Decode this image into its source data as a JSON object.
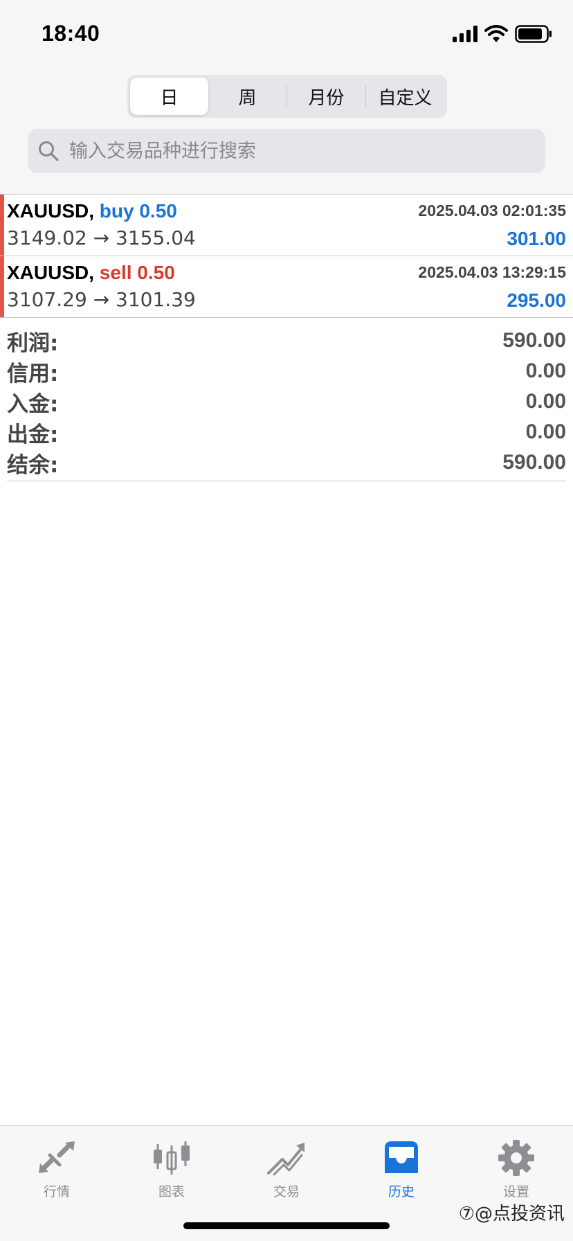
{
  "status_bar": {
    "time": "18:40"
  },
  "period_tabs": [
    {
      "label": "日",
      "active": true
    },
    {
      "label": "周",
      "active": false
    },
    {
      "label": "月份",
      "active": false
    },
    {
      "label": "自定义",
      "active": false
    }
  ],
  "search": {
    "placeholder": "输入交易品种进行搜索"
  },
  "trades": [
    {
      "symbol": "XAUUSD,",
      "side": "buy 0.50",
      "time": "2025.04.03 02:01:35",
      "prices": "3149.02 → 3155.04",
      "profit": "301.00"
    },
    {
      "symbol": "XAUUSD,",
      "side": "sell 0.50",
      "time": "2025.04.03 13:29:15",
      "prices": "3107.29 → 3101.39",
      "profit": "295.00"
    }
  ],
  "summary": [
    {
      "label": "利润:",
      "value": "590.00"
    },
    {
      "label": "信用:",
      "value": "0.00"
    },
    {
      "label": "入金:",
      "value": "0.00"
    },
    {
      "label": "出金:",
      "value": "0.00"
    },
    {
      "label": "结余:",
      "value": "590.00"
    }
  ],
  "tabbar": [
    {
      "label": "行情",
      "icon": "quotes-arrows-icon",
      "active": false
    },
    {
      "label": "图表",
      "icon": "candlestick-chart-icon",
      "active": false
    },
    {
      "label": "交易",
      "icon": "trade-trend-icon",
      "active": false
    },
    {
      "label": "历史",
      "icon": "history-inbox-icon",
      "active": true
    },
    {
      "label": "设置",
      "icon": "gear-icon",
      "active": false
    }
  ],
  "watermark": "⑦@点投资讯",
  "colors": {
    "buy": "#1a73d9",
    "sell": "#d93a2b",
    "profit": "#1a73d9",
    "trade_bar": "#e4534a",
    "tab_active": "#1a73d9",
    "tab_inactive": "#8e8e93"
  }
}
